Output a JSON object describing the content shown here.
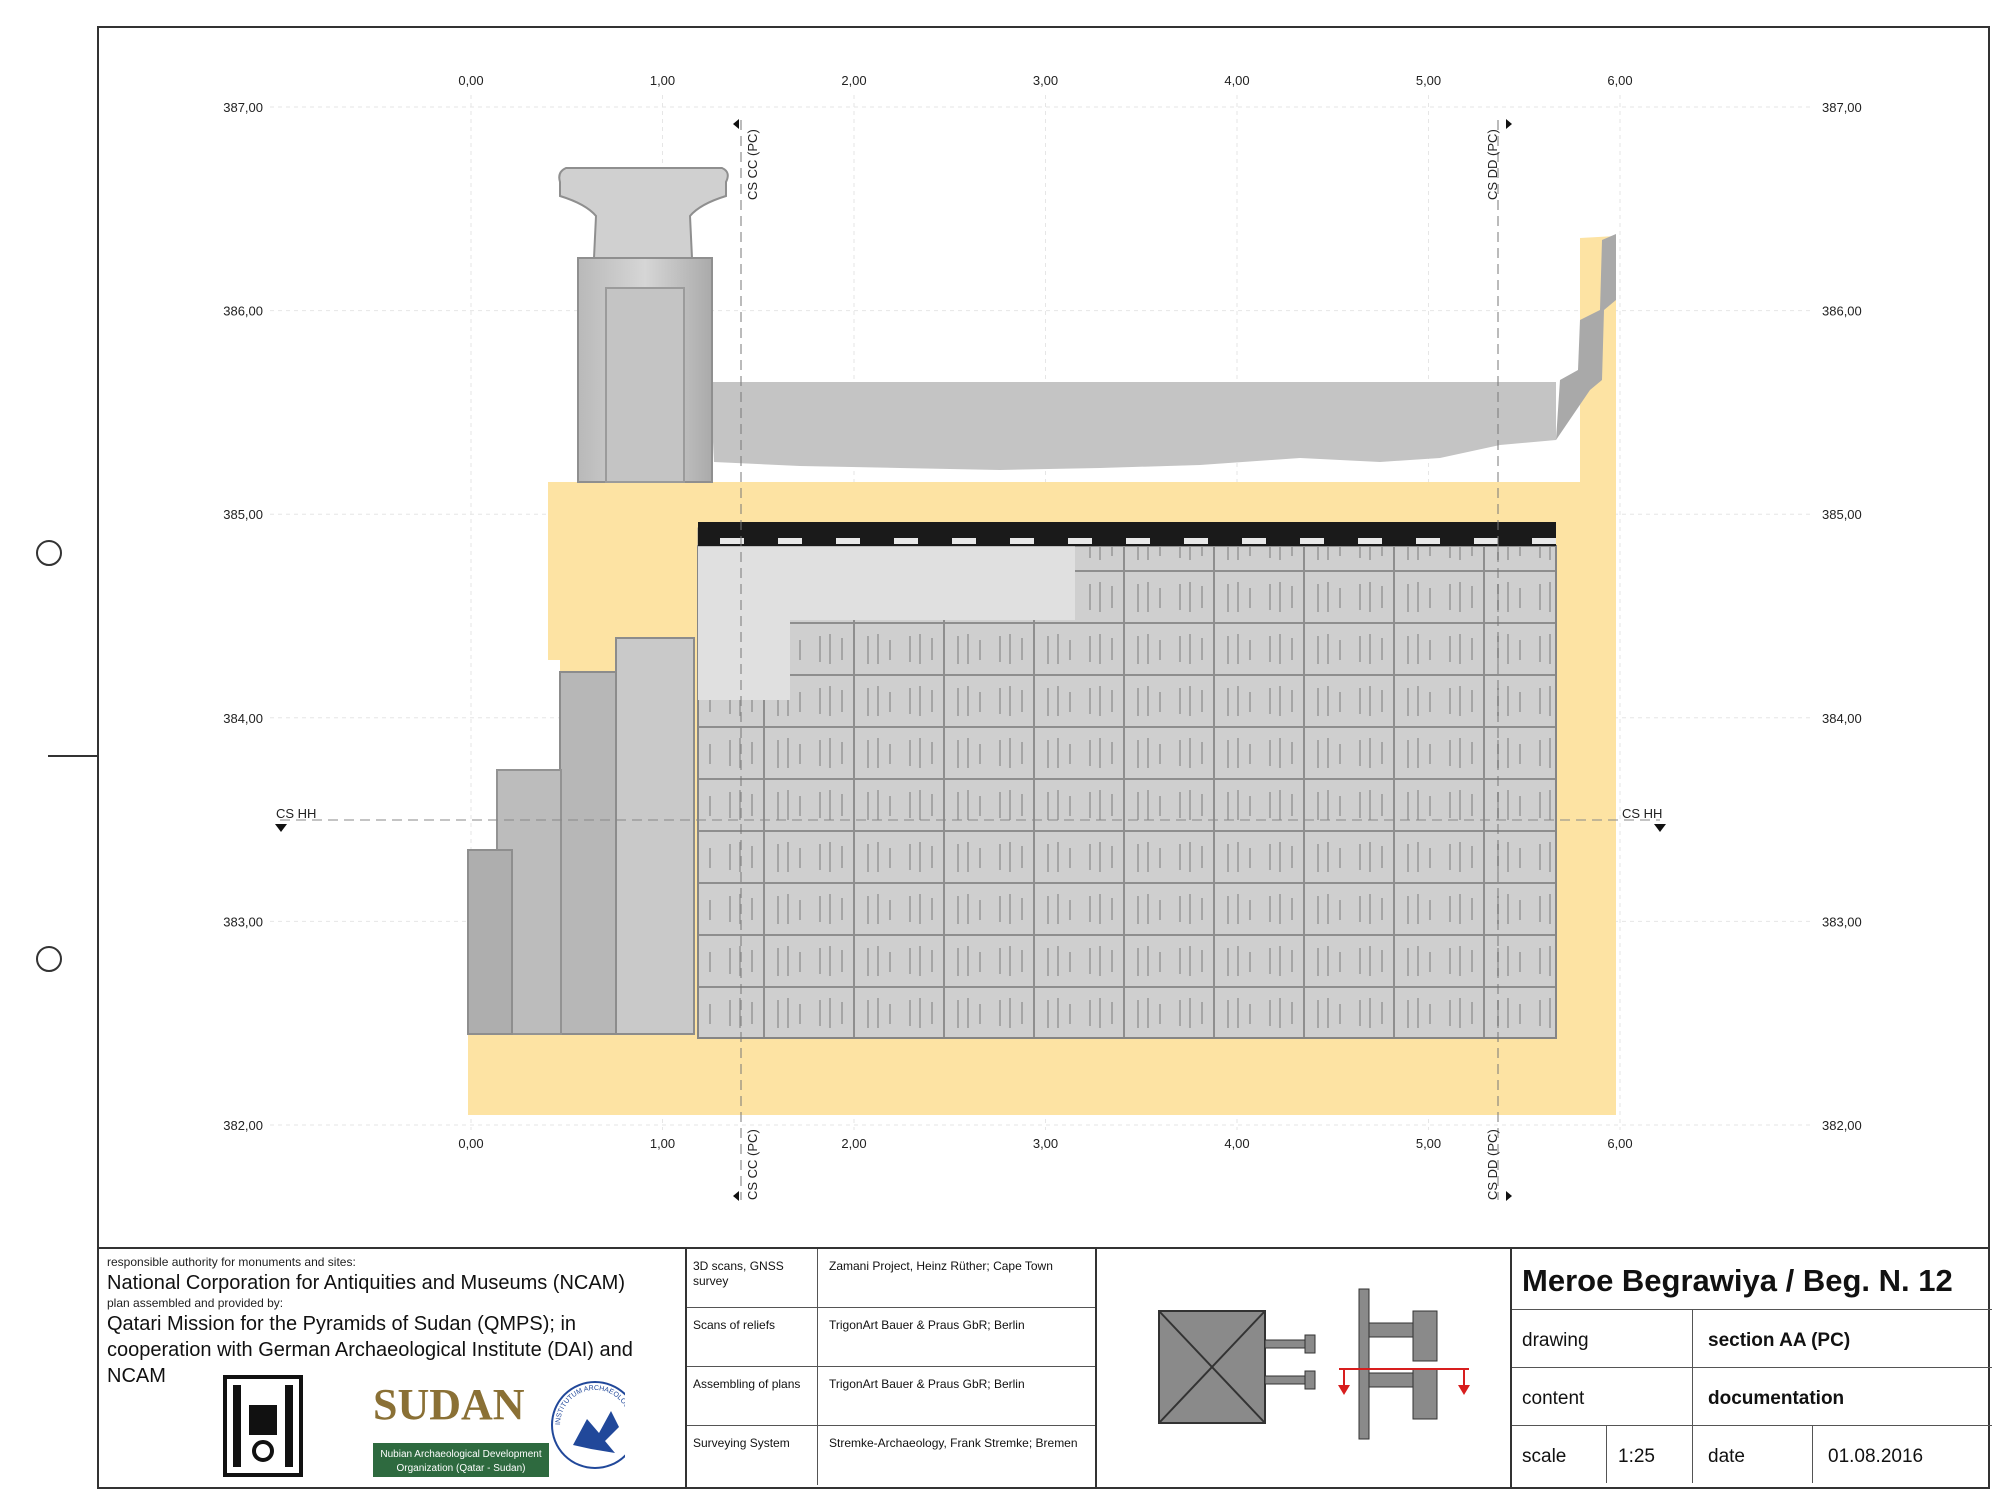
{
  "axes": {
    "x_ticks": [
      "0,00",
      "1,00",
      "2,00",
      "3,00",
      "4,00",
      "5,00",
      "6,00"
    ],
    "y_ticks": [
      "387,00",
      "386,00",
      "385,00",
      "384,00",
      "383,00",
      "382,00"
    ],
    "section_markers": {
      "cs_cc": "CS CC (PC)",
      "cs_dd": "CS DD (PC)",
      "cs_hh": "CS HH"
    }
  },
  "colors": {
    "section_fill": "#fde3a3",
    "stone": "#d2d2d2",
    "lintel": "#1a1a1a",
    "arrow": "#d81e1e"
  },
  "title_block": {
    "authority_label": "responsible authority for monuments and sites:",
    "authority": "National Corporation for Antiquities and Museums (NCAM)",
    "provided_label": "plan assembled and provided by:",
    "provided_by_1": "Qatari Mission for the Pyramids of Sudan (QMPS); in",
    "provided_by_2": "cooperation with German Archaeological Institute (DAI) and",
    "provided_by_3": "NCAM",
    "logos": {
      "sudan_text": "SUDAN",
      "nadop_line1": "Nubian Archaeological Development",
      "nadop_line2": "Organization (Qatar - Sudan)",
      "dai_text": "INSTITUTUM ARCHAEOLOGICUM GERMANICUM"
    },
    "credits": [
      {
        "role": "3D scans, GNSS survey",
        "name": "Zamani Project, Heinz Rüther; Cape Town"
      },
      {
        "role": "Scans of reliefs",
        "name": "TrigonArt Bauer & Praus GbR; Berlin"
      },
      {
        "role": "Assembling of plans",
        "name": "TrigonArt Bauer & Praus GbR; Berlin"
      },
      {
        "role": "Surveying System",
        "name": "Stremke-Archaeology, Frank Stremke; Bremen"
      }
    ],
    "title": "Meroe Begrawiya / Beg. N. 12",
    "drawing_label": "drawing",
    "drawing_value": "section AA (PC)",
    "content_label": "content",
    "content_value": "documentation",
    "scale_label": "scale",
    "scale_value": "1:25",
    "date_label": "date",
    "date_value": "01.08.2016"
  }
}
